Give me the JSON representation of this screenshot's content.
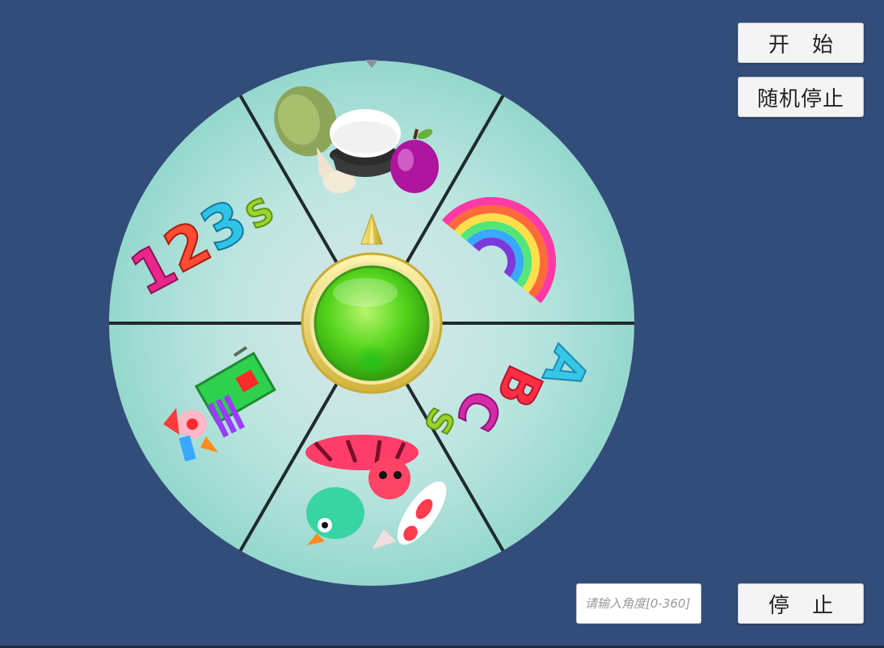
{
  "controls": {
    "start_label": "开 始",
    "random_stop_label": "随机停止",
    "stop_label": "停 止",
    "angle_placeholder": "请输入角度[0-360]"
  },
  "wheel": {
    "sector_count": 6,
    "sectors": [
      {
        "name": "food",
        "icon": "food-icon"
      },
      {
        "name": "rainbow",
        "icon": "rainbow-icon"
      },
      {
        "name": "letters",
        "icon": "abcs-icon",
        "glyphs": [
          "A",
          "B",
          "C",
          "S"
        ]
      },
      {
        "name": "animals",
        "icon": "animals-icon"
      },
      {
        "name": "toy",
        "icon": "jack-in-the-box-icon"
      },
      {
        "name": "numbers",
        "icon": "numbers-icon",
        "glyphs": [
          "1",
          "2",
          "3",
          "S"
        ]
      }
    ],
    "colors": {
      "background": "#324d79",
      "wheel_fill": "#a6dfd7",
      "divider": "#1f2a2d",
      "hub_green": "#55d51d",
      "hub_ring": "#e6c94a"
    }
  }
}
